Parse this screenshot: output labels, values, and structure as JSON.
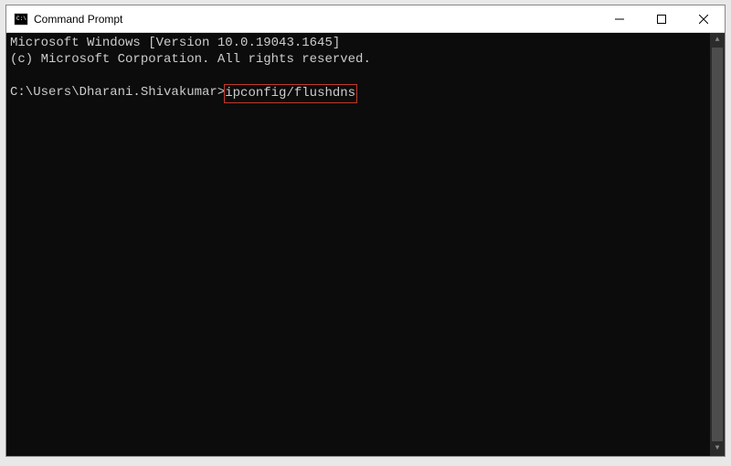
{
  "window": {
    "title": "Command Prompt"
  },
  "terminal": {
    "line1": "Microsoft Windows [Version 10.0.19043.1645]",
    "line2": "(c) Microsoft Corporation. All rights reserved.",
    "prompt": "C:\\Users\\Dharani.Shivakumar>",
    "command": "ipconfig/flushdns"
  }
}
